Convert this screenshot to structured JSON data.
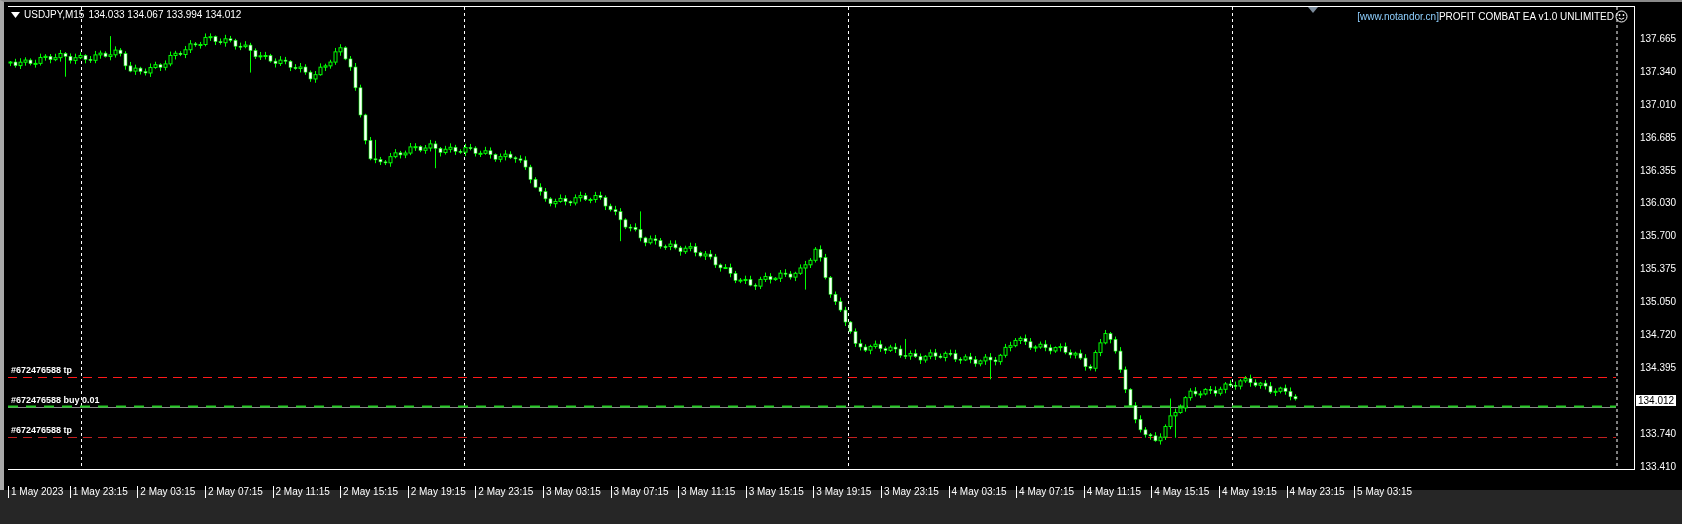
{
  "chart": {
    "symbol": "USDJPY,M15",
    "ohlc": "134.033 134.067 133.994 134.012",
    "ea_label": {
      "source": "[www.notandor.cn]",
      "name": "PROFIT COMBAT EA v1.0 UNLIMITED"
    },
    "price_axis": [
      "137.665",
      "137.340",
      "137.010",
      "136.685",
      "136.355",
      "136.030",
      "135.700",
      "135.375",
      "135.050",
      "134.720",
      "134.395",
      "133.740",
      "133.410"
    ],
    "current_price": "134.012",
    "order_lines": [
      {
        "kind": "tp",
        "label": "#672476588 tp"
      },
      {
        "kind": "entry",
        "label": "#672476588 buy 0.01"
      },
      {
        "kind": "tp",
        "label": "#672476588 tp"
      }
    ],
    "time_axis": [
      "1 May 2023",
      "1 May 23:15",
      "2 May 03:15",
      "2 May 07:15",
      "2 May 11:15",
      "2 May 15:15",
      "2 May 19:15",
      "2 May 23:15",
      "3 May 03:15",
      "3 May 07:15",
      "3 May 11:15",
      "3 May 15:15",
      "3 May 19:15",
      "3 May 23:15",
      "4 May 03:15",
      "4 May 07:15",
      "4 May 11:15",
      "4 May 15:15",
      "4 May 19:15",
      "4 May 23:15",
      "5 May 03:15"
    ]
  }
}
